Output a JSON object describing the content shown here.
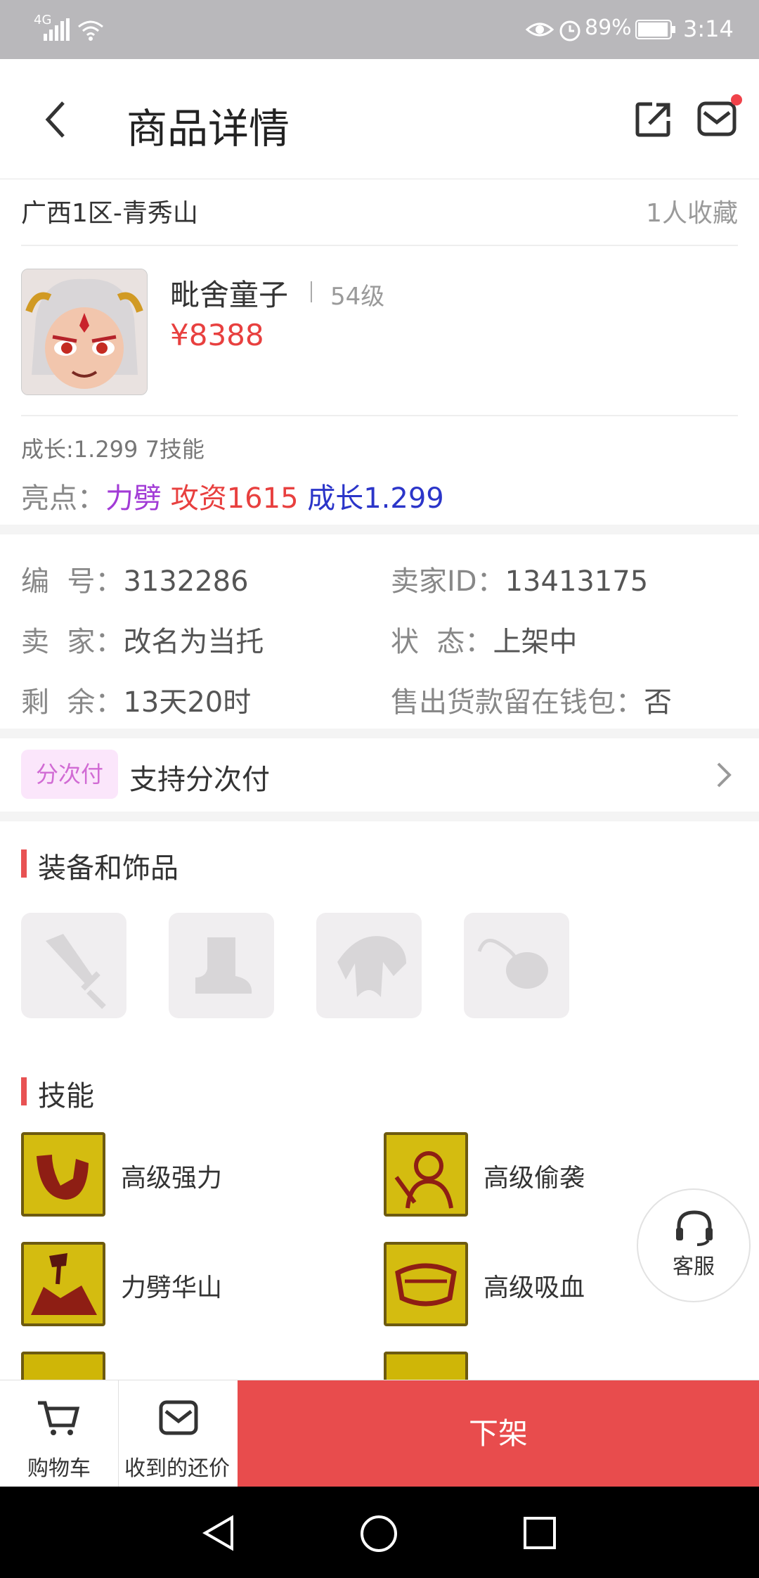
{
  "status_bar": {
    "network": "4G",
    "battery": "89%",
    "time": "3:14"
  },
  "header": {
    "title": "商品详情"
  },
  "listing": {
    "server": "广西1区-青秀山",
    "favorites": "1人收藏",
    "name": "毗舍童子",
    "level": "54级",
    "price": "¥8388",
    "summary": "成长:1.299 7技能",
    "highlights_label": "亮点：",
    "highlights": [
      {
        "text": "力劈",
        "color": "#a23bd6"
      },
      {
        "text": "攻资1615",
        "color": "#e8403f"
      },
      {
        "text": "成长1.299",
        "color": "#2b35c9"
      }
    ]
  },
  "details": {
    "id_label": "编  号：",
    "id_value": "3132286",
    "seller_id_label": "卖家ID：",
    "seller_id_value": "13413175",
    "seller_label": "卖  家：",
    "seller_value": "改名为当托",
    "status_label": "状  态：",
    "status_value": "上架中",
    "remaining_label": "剩  余：",
    "remaining_value": "13天20时",
    "wallet_label": "售出货款留在钱包：",
    "wallet_value": "否"
  },
  "installment": {
    "badge": "分次付",
    "text": "支持分次付"
  },
  "equipment": {
    "title": "装备和饰品",
    "slots": [
      "weapon-icon",
      "boots-icon",
      "armor-icon",
      "accessory-icon"
    ]
  },
  "skills": {
    "title": "技能",
    "items": [
      {
        "name": "高级强力",
        "icon": "strength-skill-icon"
      },
      {
        "name": "高级偷袭",
        "icon": "sneak-attack-skill-icon"
      },
      {
        "name": "力劈华山",
        "icon": "cleave-skill-icon"
      },
      {
        "name": "高级吸血",
        "icon": "lifesteal-skill-icon"
      }
    ]
  },
  "service": {
    "label": "客服"
  },
  "bottom_bar": {
    "cart_label": "购物车",
    "offers_label": "收到的还价",
    "delist_label": "下架"
  },
  "colors": {
    "accent": "#e84c4d",
    "price": "#e8403f",
    "badge_bg": "#fbe6fb",
    "badge_text": "#d16bd4"
  }
}
